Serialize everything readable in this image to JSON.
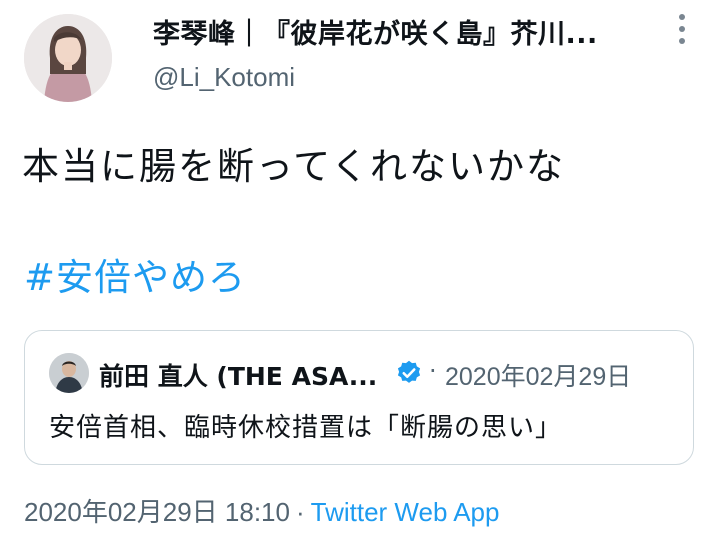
{
  "tweet": {
    "author_name": "李琴峰｜『彼岸花が咲く島』芥川...",
    "author_handle": "@Li_Kotomi",
    "text": "本当に腸を断ってくれないかな",
    "hashtag": "#安倍やめろ"
  },
  "quoted": {
    "author_name": "前田 直人 (THE ASA...",
    "separator": "·",
    "date": "2020年02月29日",
    "text": "安倍首相、臨時休校措置は「断腸の思い」"
  },
  "meta": {
    "timestamp": "2020年02月29日 18:10",
    "separator": "·",
    "source": "Twitter Web App"
  },
  "icons": {
    "more": "more-vertical-icon",
    "verified": "verified-badge-icon"
  },
  "colors": {
    "link": "#1d9bf0",
    "secondary_text": "#536471",
    "primary_text": "#0f1419",
    "border": "#cfd9de"
  }
}
